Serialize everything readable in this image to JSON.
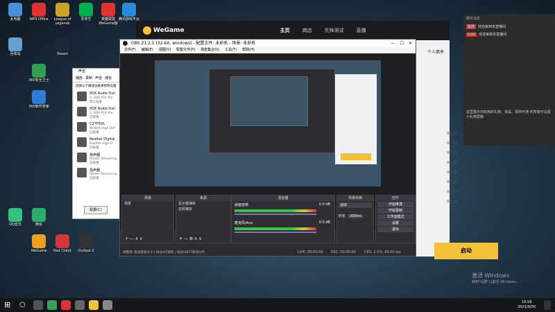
{
  "desktop_icons": [
    {
      "label": "此电脑",
      "color": "#4a90d9"
    },
    {
      "label": "WPS Office",
      "color": "#d33"
    },
    {
      "label": "League of Legends",
      "color": "#c9a227"
    },
    {
      "label": "爱奇艺",
      "color": "#00b050"
    },
    {
      "label": "英雄联盟\nWeGame版",
      "color": "#d33"
    },
    {
      "label": "腾讯游戏平台",
      "color": "#2a8ae0"
    },
    {
      "label": "Steam",
      "color": "#1b2838"
    },
    {
      "label": "回收站",
      "color": "#6aa0d0"
    },
    {
      "label": "360安全卫士",
      "color": "#30a050"
    },
    {
      "label": "360软件管家",
      "color": "#2e7bd6"
    },
    {
      "label": "QQ音乐",
      "color": "#31c27c"
    },
    {
      "label": "微信",
      "color": "#2aae67"
    },
    {
      "label": "WeGame",
      "color": "#f0a020"
    },
    {
      "label": "Riot Client",
      "color": "#d13639"
    },
    {
      "label": "Outlast 2",
      "color": "#333"
    }
  ],
  "wegame": {
    "logo": "WeGame",
    "nav": [
      {
        "label": "主页",
        "active": true
      },
      {
        "label": "商店"
      },
      {
        "label": "先锋测试"
      },
      {
        "label": "直播"
      }
    ],
    "launch_label": "启动",
    "tabs": [
      "个人赛季"
    ],
    "dates": [
      "08-29",
      "08-29",
      "08-29",
      "08-29",
      "08-29",
      "08-29",
      "08-29",
      "08-29"
    ]
  },
  "obs": {
    "title": "OBS 21.2.1 (32-bit, windows) - 配置文件: 未命名 - 场景: 未命名",
    "menu": [
      "文件(F)",
      "编辑(E)",
      "视图(V)",
      "配置文件(P)",
      "场景集合(S)",
      "工具(T)",
      "帮助(H)"
    ],
    "docks": {
      "scenes": {
        "title": "场景",
        "items": [
          "场景"
        ]
      },
      "sources": {
        "title": "来源",
        "items": [
          "显示器捕获",
          "音频捕获"
        ]
      },
      "mixer": {
        "title": "混音器",
        "tracks": [
          {
            "name": "桌面音频",
            "level": "0.0 dB"
          },
          {
            "name": "麦克风/Aux",
            "level": "0.0 dB"
          }
        ]
      },
      "transition": {
        "title": "场景转换",
        "mode": "淡出",
        "duration_label": "时长",
        "duration": "300ms"
      },
      "controls": {
        "title": "控件",
        "buttons": [
          "开始推流",
          "开始录制",
          "工作室模式",
          "设置",
          "退出"
        ]
      }
    },
    "status": {
      "live": "LIVE: 00:00:00",
      "rec": "REC: 00:00:00",
      "cpu": "CPU: 1.0%, 60.00 fps"
    },
    "hint": "调整源: 拖动改变大小 | 按住ALT裁剪 | 按住SHIFT保持比例"
  },
  "sound_dialog": {
    "title": "声音",
    "tabs": [
      "播放",
      "录制",
      "声音",
      "通信"
    ],
    "instruction": "选择以下播放设备来修改设置:",
    "devices": [
      {
        "name": "XOX Audio Out",
        "sub": "2- XOX P10 Pro",
        "state": "默认设备"
      },
      {
        "name": "XOX Audio Out",
        "sub": "2- XOX P10 Pro",
        "state": "已就绪"
      },
      {
        "name": "C27F591",
        "sub": "NVIDIA High Def",
        "state": "已就绪"
      },
      {
        "name": "Realtek Digital",
        "sub": "Realtek High D",
        "state": "已就绪"
      },
      {
        "name": "扬声器",
        "sub": "Steam Streaming",
        "state": "已就绪"
      },
      {
        "name": "扬声器",
        "sub": "Steam Streaming",
        "state": "已就绪"
      }
    ],
    "config_button": "配置(C)"
  },
  "chat": {
    "title": "聊天消息",
    "lines": [
      {
        "tag": "系统",
        "text": "欢迎来到本直播间"
      },
      {
        "tag": "1/10",
        "text": "欢迎来到本直播间"
      }
    ],
    "notice": "这里展示你收到的礼物、道具、贵族开通 你所有可设置小礼物屏蔽"
  },
  "activation": {
    "line1": "激活 Windows",
    "line2": "转到\"设置\"以激活 Windows。"
  },
  "clock": {
    "time": "16:58",
    "date": "2021/9/30"
  },
  "colors": {
    "accent": "#f2c33a",
    "obs_red": "#d13639",
    "meter_green": "#3cc24a"
  }
}
